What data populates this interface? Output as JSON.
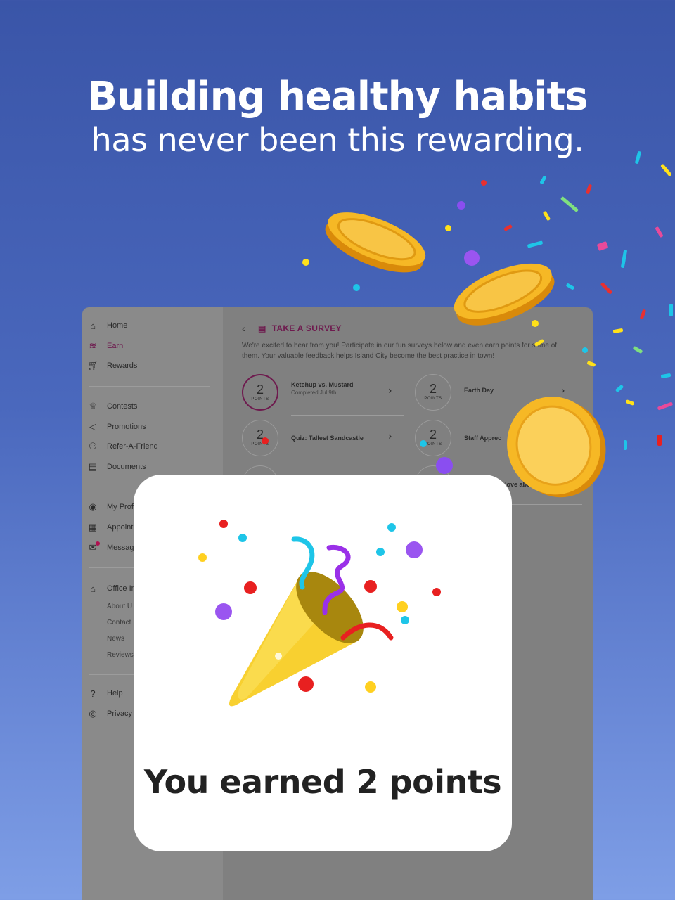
{
  "headline": {
    "title": "Building healthy habits",
    "subtitle": "has never been this rewarding."
  },
  "sidebar": {
    "primary": [
      {
        "label": "Home",
        "icon": "home-icon",
        "active": false
      },
      {
        "label": "Earn",
        "icon": "coins-icon",
        "active": true
      },
      {
        "label": "Rewards",
        "icon": "cart-icon",
        "active": false
      }
    ],
    "engage": [
      {
        "label": "Contests",
        "icon": "trophy-icon"
      },
      {
        "label": "Promotions",
        "icon": "megaphone-icon"
      },
      {
        "label": "Refer-A-Friend",
        "icon": "people-icon"
      },
      {
        "label": "Documents",
        "icon": "document-icon"
      }
    ],
    "account": [
      {
        "label": "My Prof",
        "icon": "user-icon"
      },
      {
        "label": "Appoint",
        "icon": "calendar-icon"
      },
      {
        "label": "Messag",
        "icon": "mail-icon"
      }
    ],
    "office": {
      "label": "Office In",
      "icon": "building-icon"
    },
    "office_sub": [
      "About U",
      "Contact",
      "News",
      "Reviews"
    ],
    "support": [
      {
        "label": "Help",
        "icon": "help-icon"
      },
      {
        "label": "Privacy",
        "icon": "eye-icon"
      }
    ]
  },
  "survey": {
    "title": "TAKE A SURVEY",
    "description": "We're excited to hear from you! Participate in our fun surveys below and even earn points for some of them. Your valuable feedback helps Island City become the best practice in town!",
    "points_label": "POINTS",
    "items": [
      {
        "points": "2",
        "name": "Ketchup vs. Mustard",
        "status": "Completed Jul 9th",
        "completed": true
      },
      {
        "points": "2",
        "name": "Earth Day",
        "status": "",
        "completed": false
      },
      {
        "points": "2",
        "name": "Quiz: Tallest Sandcastle",
        "status": "",
        "completed": false
      },
      {
        "points": "2",
        "name": "Staff Apprec",
        "status": "",
        "completed": false
      },
      {
        "points": "",
        "name": "",
        "status": "",
        "completed": false
      },
      {
        "points": "",
        "name": "love abo",
        "status": "",
        "completed": false
      }
    ]
  },
  "modal": {
    "icon": "party-popper-icon",
    "message": "You earned 2 points"
  },
  "colors": {
    "brand": "#6e1a4e",
    "bg_top": "#3a55a8",
    "bg_bottom": "#7e9ee6",
    "coin": "#f5b21e"
  }
}
